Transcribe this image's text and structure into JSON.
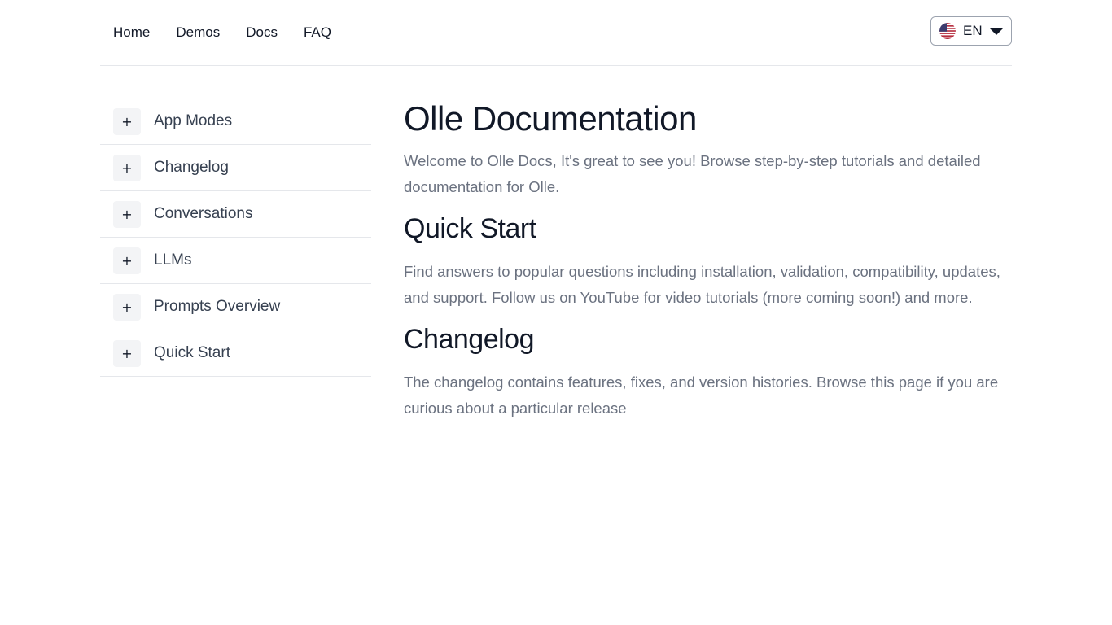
{
  "nav": {
    "items": [
      {
        "label": "Home"
      },
      {
        "label": "Demos"
      },
      {
        "label": "Docs"
      },
      {
        "label": "FAQ"
      }
    ]
  },
  "language": {
    "selected": "EN",
    "flag_icon": "us-flag-icon"
  },
  "sidebar": {
    "items": [
      {
        "label": "App Modes",
        "toggle": "+"
      },
      {
        "label": "Changelog",
        "toggle": "+"
      },
      {
        "label": "Conversations",
        "toggle": "+"
      },
      {
        "label": "LLMs",
        "toggle": "+"
      },
      {
        "label": "Prompts Overview",
        "toggle": "+"
      },
      {
        "label": "Quick Start",
        "toggle": "+"
      }
    ]
  },
  "main": {
    "title": "Olle Documentation",
    "intro": "Welcome to Olle Docs, It's great to see you! Browse step-by-step tutorials and detailed documentation for Olle.",
    "sections": [
      {
        "heading": "Quick Start",
        "text": "Find answers to popular questions including installation, validation, compatibility, updates, and support. Follow us on YouTube for video tutorials (more coming soon!) and more."
      },
      {
        "heading": "Changelog",
        "text": "The changelog contains features, fixes, and version histories. Browse this page if you are curious about a particular release"
      }
    ]
  },
  "colors": {
    "heading": "#111827",
    "body_text": "#6b7280",
    "divider": "#e5e7eb",
    "toggle_bg": "#f3f4f6"
  }
}
